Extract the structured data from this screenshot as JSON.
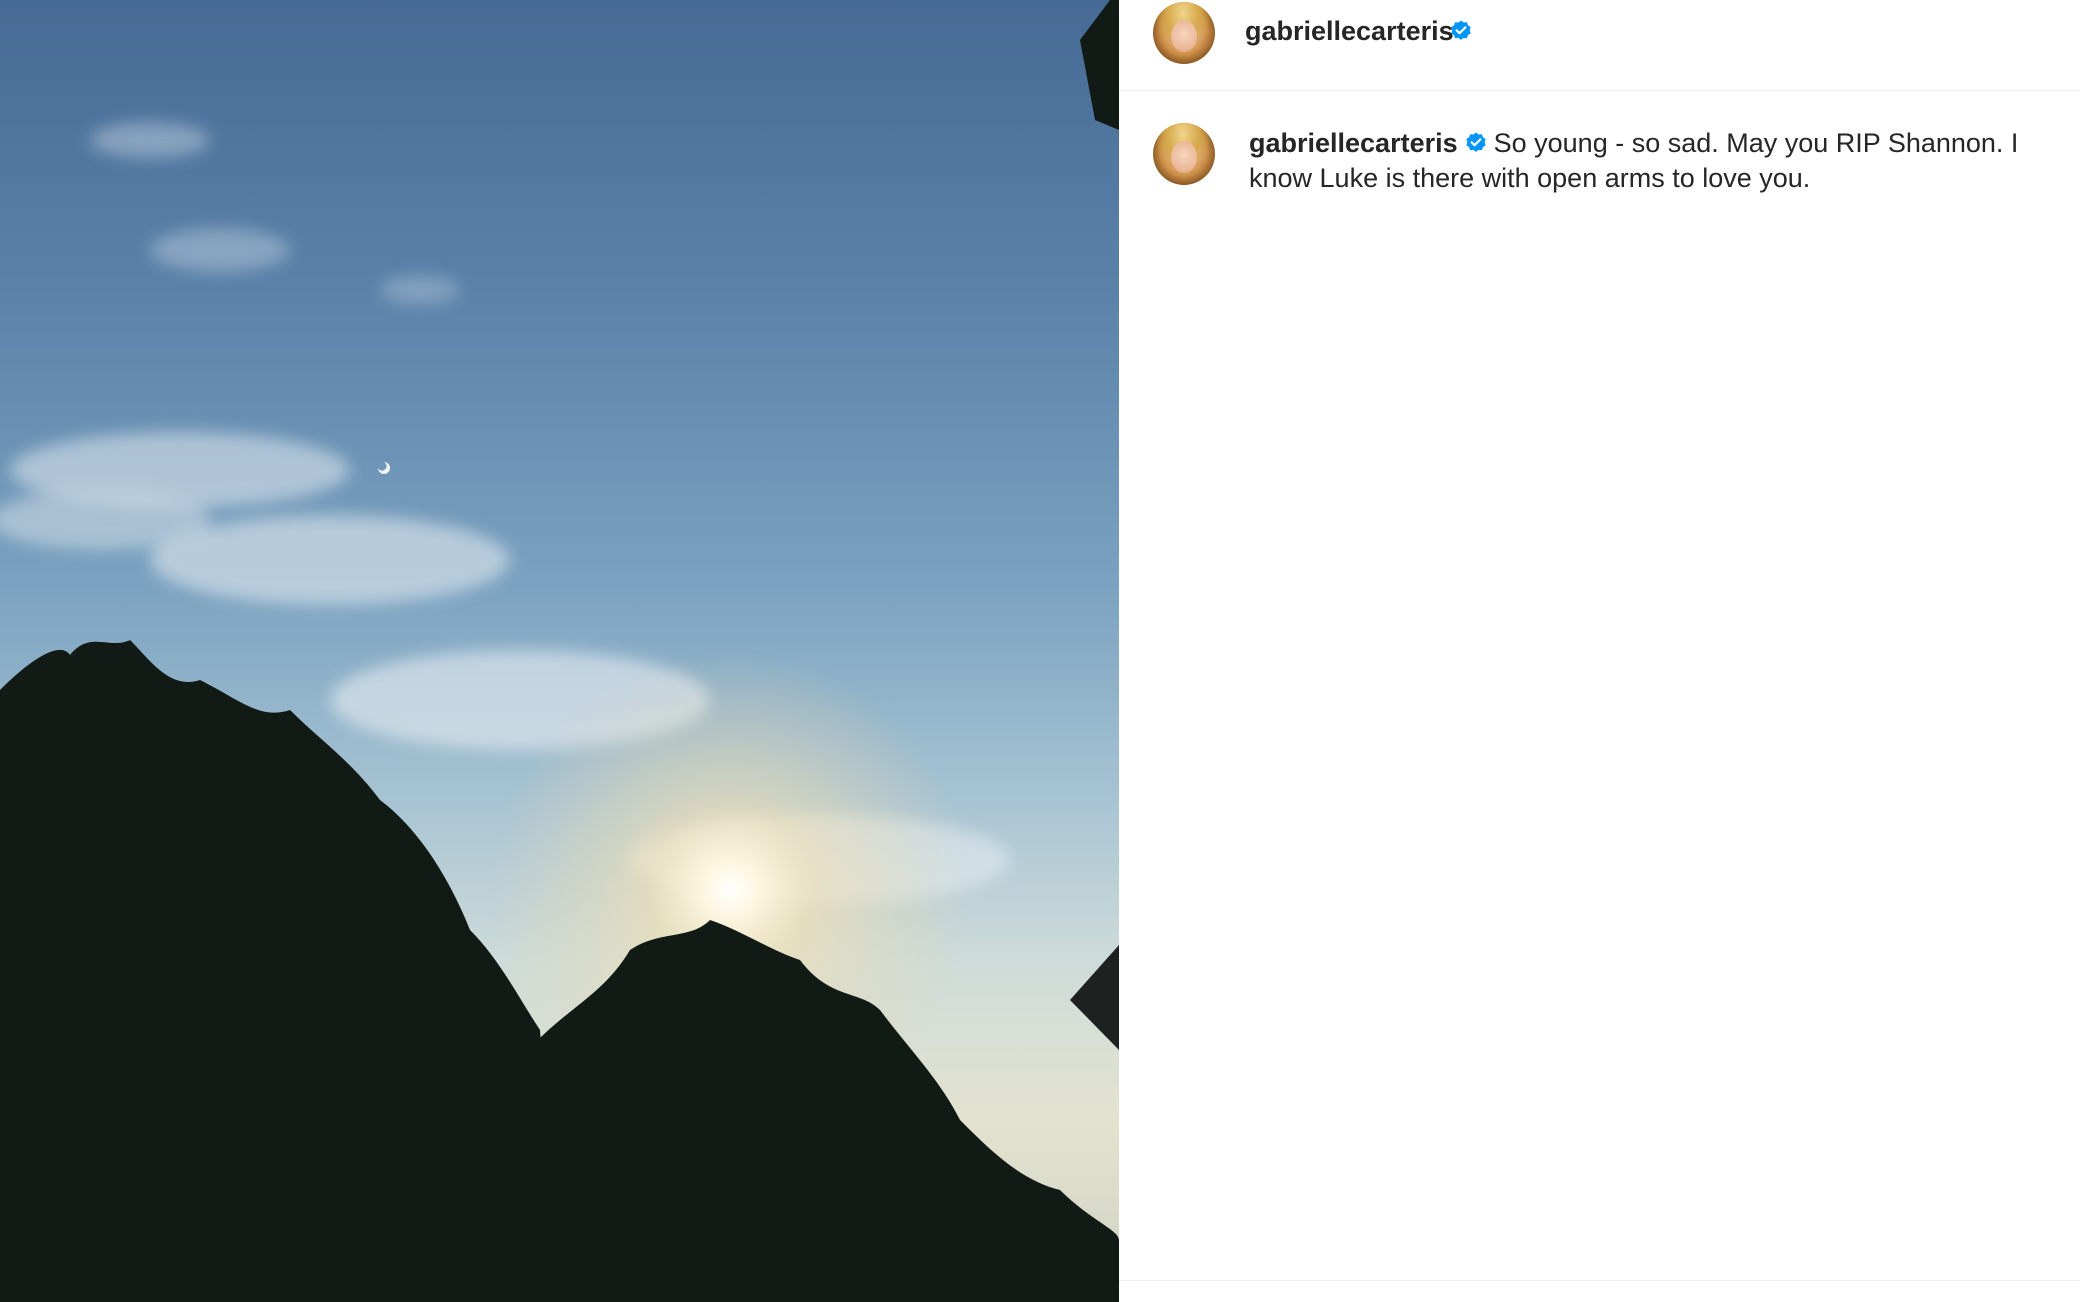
{
  "post": {
    "author": {
      "username": "gabriellecarteris",
      "verified": true,
      "avatar_icon": "profile-photo"
    },
    "caption": {
      "username": "gabriellecarteris",
      "text": "So young - so sad. May you RIP Shannon. I know Luke is there with open arms to love you."
    },
    "photo": {
      "description_icon": "sky-sunset-photo"
    },
    "colors": {
      "verified_badge": "#0095f6",
      "text": "#262626",
      "divider": "#efefef"
    }
  }
}
